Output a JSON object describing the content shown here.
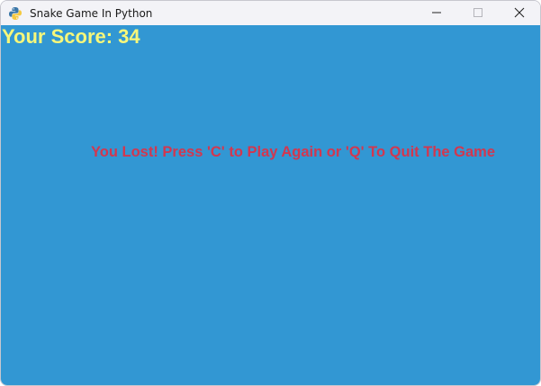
{
  "window": {
    "title": "Snake Game In Python",
    "app_icon": "python-icon",
    "controls": {
      "minimize_icon": "minimize-icon",
      "maximize_icon": "maximize-icon",
      "close_icon": "close-icon"
    }
  },
  "game": {
    "score_text": "Your Score: 34",
    "message_text": "You Lost! Press 'C' to Play Again or 'Q' To Quit The Game",
    "colors": {
      "background": "#3297d3",
      "score": "#f7f77a",
      "message": "#d2374f"
    }
  }
}
